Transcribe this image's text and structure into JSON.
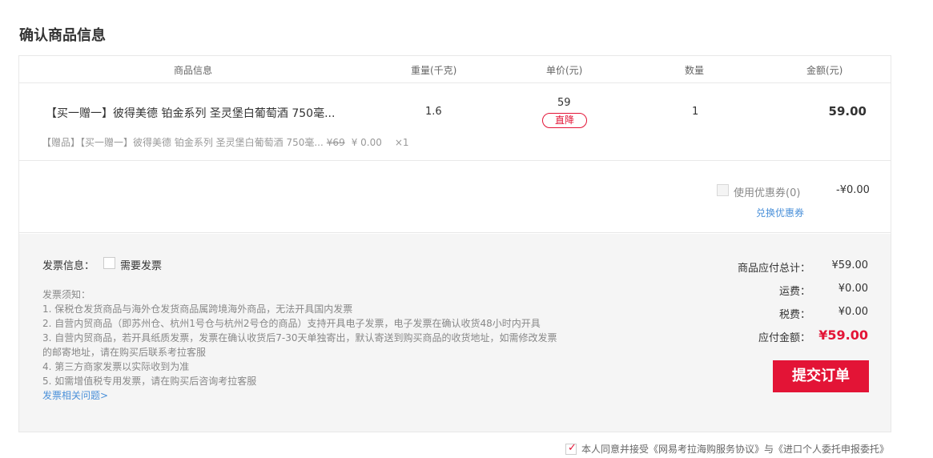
{
  "page_title": "确认商品信息",
  "table_headers": {
    "info": "商品信息",
    "weight": "重量(千克)",
    "price": "单价(元)",
    "qty": "数量",
    "amount": "金额(元)"
  },
  "product": {
    "name": "【买一赠一】彼得美德 铂金系列 圣灵堡白葡萄酒 750毫...",
    "weight": "1.6",
    "price": "59",
    "price_tag": "直降",
    "qty": "1",
    "amount": "59.00"
  },
  "gift": {
    "label": "【赠品】【买一赠一】彼得美德 铂金系列 圣灵堡白葡萄酒 750毫...",
    "original_price": "¥69",
    "price": "¥ 0.00",
    "qty": "×1"
  },
  "coupon": {
    "label": "使用优惠券(0)",
    "value": "-¥0.00",
    "exchange_link": "兑换优惠券"
  },
  "invoice": {
    "title": "发票信息：",
    "need_label": "需要发票",
    "notice_title": "发票须知：",
    "notice_lines": [
      "1. 保税仓发货商品与海外仓发货商品属跨境海外商品，无法开具国内发票",
      "2. 自营内贸商品（即苏州仓、杭州1号仓与杭州2号仓的商品）支持开具电子发票，电子发票在确认收货48小时内开具",
      "3. 自营内贸商品，若开具纸质发票，发票在确认收货后7-30天单独寄出，默认寄送到购买商品的收货地址，如需修改发票",
      "的邮寄地址，请在购买后联系考拉客服",
      "4. 第三方商家发票以实际收到为准",
      "5. 如需增值税专用发票，请在购买后咨询考拉客服"
    ],
    "help_link": "发票相关问题>"
  },
  "summary": {
    "goods_total_label": "商品应付总计：",
    "goods_total_value": "¥59.00",
    "shipping_label": "运费：",
    "shipping_value": "¥0.00",
    "tax_label": "税费：",
    "tax_value": "¥0.00",
    "payable_label": "应付金额：",
    "payable_value": "¥59.00"
  },
  "submit_label": "提交订单",
  "agreement": {
    "text": "本人同意并接受《网易考拉海购服务协议》与《进口个人委托申报委托》",
    "checked": true
  },
  "colors": {
    "accent": "#e31436",
    "link": "#4a90d9"
  }
}
